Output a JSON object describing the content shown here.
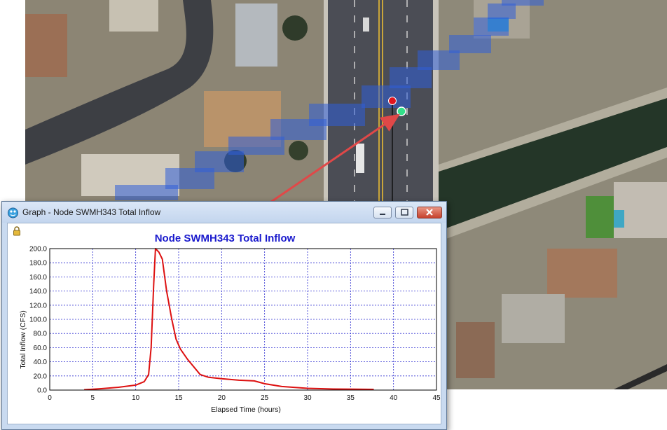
{
  "window": {
    "title": "Graph - Node SWMH343 Total Inflow",
    "buttons": [
      "minimize",
      "maximize",
      "close"
    ]
  },
  "icons": {
    "app": "graph-app-icon",
    "lock": "lock-icon"
  },
  "map": {
    "node_marker_color": "#e0141e",
    "outfall_marker_color": "#33e08a",
    "flood_overlay_color": "#2f5fd8",
    "callout_arrow_color": "#e04848"
  },
  "chart_data": {
    "type": "line",
    "title": "Node SWMH343 Total Inflow",
    "xlabel": "Elapsed Time (hours)",
    "ylabel": "Total Inflow (CFS)",
    "xlim": [
      0,
      45
    ],
    "ylim": [
      0,
      200
    ],
    "xticks": [
      "0",
      "5",
      "10",
      "15",
      "20",
      "25",
      "30",
      "35",
      "40",
      "45"
    ],
    "yticks": [
      "0.0",
      "20.0",
      "40.0",
      "60.0",
      "80.0",
      "100.0",
      "120.0",
      "140.0",
      "160.0",
      "180.0",
      "200.0"
    ],
    "grid": true,
    "series": [
      {
        "color": "#dd1111",
        "points": [
          [
            4,
            0.5
          ],
          [
            6,
            2
          ],
          [
            8,
            4
          ],
          [
            10,
            7
          ],
          [
            11,
            12
          ],
          [
            11.5,
            22
          ],
          [
            11.8,
            60
          ],
          [
            12.1,
            150
          ],
          [
            12.3,
            200
          ],
          [
            12.7,
            195
          ],
          [
            13.1,
            185
          ],
          [
            13.6,
            140
          ],
          [
            14.2,
            100
          ],
          [
            14.7,
            72
          ],
          [
            15.2,
            58
          ],
          [
            16,
            44
          ],
          [
            17.5,
            22
          ],
          [
            18.5,
            18
          ],
          [
            20,
            16
          ],
          [
            22,
            14
          ],
          [
            23.8,
            13
          ],
          [
            25,
            9
          ],
          [
            27,
            5
          ],
          [
            30,
            2.5
          ],
          [
            33,
            1.5
          ],
          [
            37.7,
            1
          ]
        ]
      }
    ]
  }
}
